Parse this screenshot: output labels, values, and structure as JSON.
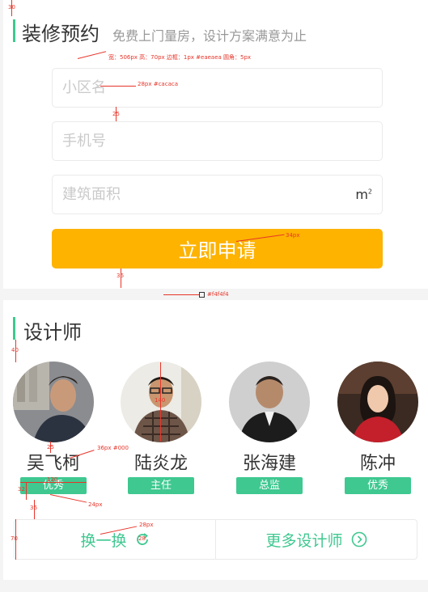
{
  "booking": {
    "title": "装修预约",
    "subtitle": "免费上门量房，设计方案满意为止",
    "community_placeholder": "小区名",
    "phone_placeholder": "手机号",
    "area_placeholder": "建筑面积",
    "area_unit": "m",
    "area_unit_sup": "2",
    "submit_label": "立即申请"
  },
  "designers": {
    "title": "设计师",
    "items": [
      {
        "name": "吴飞柯",
        "badge": "优秀"
      },
      {
        "name": "陆炎龙",
        "badge": "主任"
      },
      {
        "name": "张海建",
        "badge": "总监"
      },
      {
        "name": "陈冲",
        "badge": "优秀"
      }
    ],
    "refresh_label": "换一换",
    "more_label": "更多设计师"
  },
  "annotations": {
    "a30": "30",
    "input_spec": "宽：506px  高：70px  边框：1px #eaeaea  圆角：5px",
    "placeholder_spec": "28px #cacaca",
    "a25": "25",
    "button_font": "34px",
    "a36": "36",
    "divider_color": "#f4f4f4",
    "a40": "40",
    "avatar_size": "140",
    "a25b": "25",
    "name_spec": "36px #000",
    "badge_width": "120",
    "badge_h": "32",
    "a24": "24px",
    "a36b": "36",
    "bar_h": "70",
    "refresh_font": "28px",
    "icon_size": "28"
  },
  "colors": {
    "accent": "#3fc890",
    "button": "#fdb300",
    "border": "#eaeaea",
    "divider": "#f4f4f4",
    "annotation": "#e8352a"
  }
}
